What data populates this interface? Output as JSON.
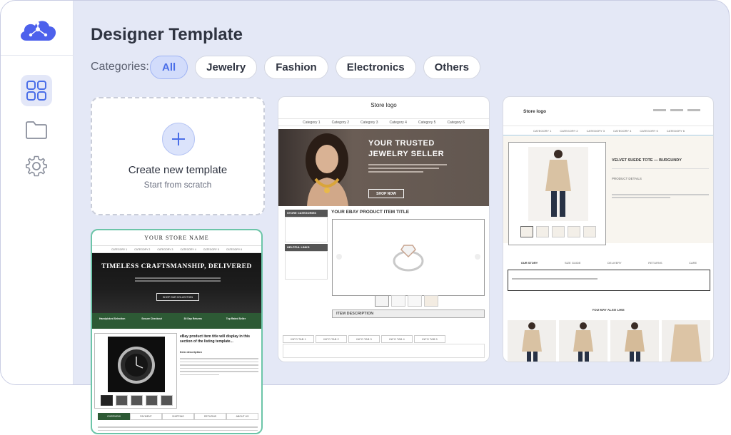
{
  "page": {
    "title": "Designer Template",
    "categories_label": "Categories:",
    "categories": [
      "All",
      "Jewelry",
      "Fashion",
      "Electronics",
      "Others"
    ]
  },
  "create": {
    "title": "Create new template",
    "subtitle": "Start from scratch"
  },
  "jewelry_template": {
    "logo": "Store logo",
    "nav": [
      "Category 1",
      "Category 2",
      "Category 3",
      "Category 4",
      "Category 5",
      "Category 6"
    ],
    "hero_title_1": "YOUR TRUSTED",
    "hero_title_2": "JEWELRY SELLER",
    "hero_button": "SHOP NOW",
    "store_categories": "STORE CATEGORIES",
    "helpful_links": "HELPFUL LINKS",
    "item_title": "YOUR EBAY PRODUCT ITEM TITLE",
    "item_description": "ITEM DESCRIPTION",
    "tabs": [
      "INFO TAB 1",
      "INFO TAB 2",
      "INFO TAB 3",
      "INFO TAB 4",
      "INFO TAB 5"
    ]
  },
  "fashion_template": {
    "logo": "Store logo",
    "nav": [
      "CATEGORY 1",
      "CATEGORY 2",
      "CATEGORY 3",
      "CATEGORY 4",
      "CATEGORY 5",
      "CATEGORY 6"
    ],
    "product_title": "VELVET SUEDE TOTE — BURGUNDY",
    "product_details": "PRODUCT DETAILS",
    "tabs": [
      "OUR STORY",
      "SIZE GUIDE",
      "DELIVERY",
      "RETURNS",
      "CARE"
    ],
    "you_may_also_like": "YOU MAY ALSO LIKE"
  },
  "watch_template": {
    "store_name": "YOUR STORE NAME",
    "nav": [
      "CATEGORY 1",
      "CATEGORY 2",
      "CATEGORY 3",
      "CATEGORY 4",
      "CATEGORY 5",
      "CATEGORY 6"
    ],
    "hero_title": "TIMELESS CRAFTSMANSHIP, DELIVERED",
    "hero_button": "SHOP OUR COLLECTION",
    "features": [
      "Handpicked Selection",
      "Secure Checkout",
      "30 Day Returns",
      "Top Rated Seller"
    ],
    "item_title": "eBay product item title will display in this section of the listing template...",
    "item_description": "Item description",
    "tabs": [
      "OVERVIEW",
      "PAYMENT",
      "SHIPPING",
      "RETURNS",
      "ABOUT US"
    ]
  },
  "colors": {
    "accent": "#4a6ee8",
    "selected_border": "#6cc5a8",
    "brand_logo": "#4d61ec",
    "watch_green": "#2d5a35"
  }
}
